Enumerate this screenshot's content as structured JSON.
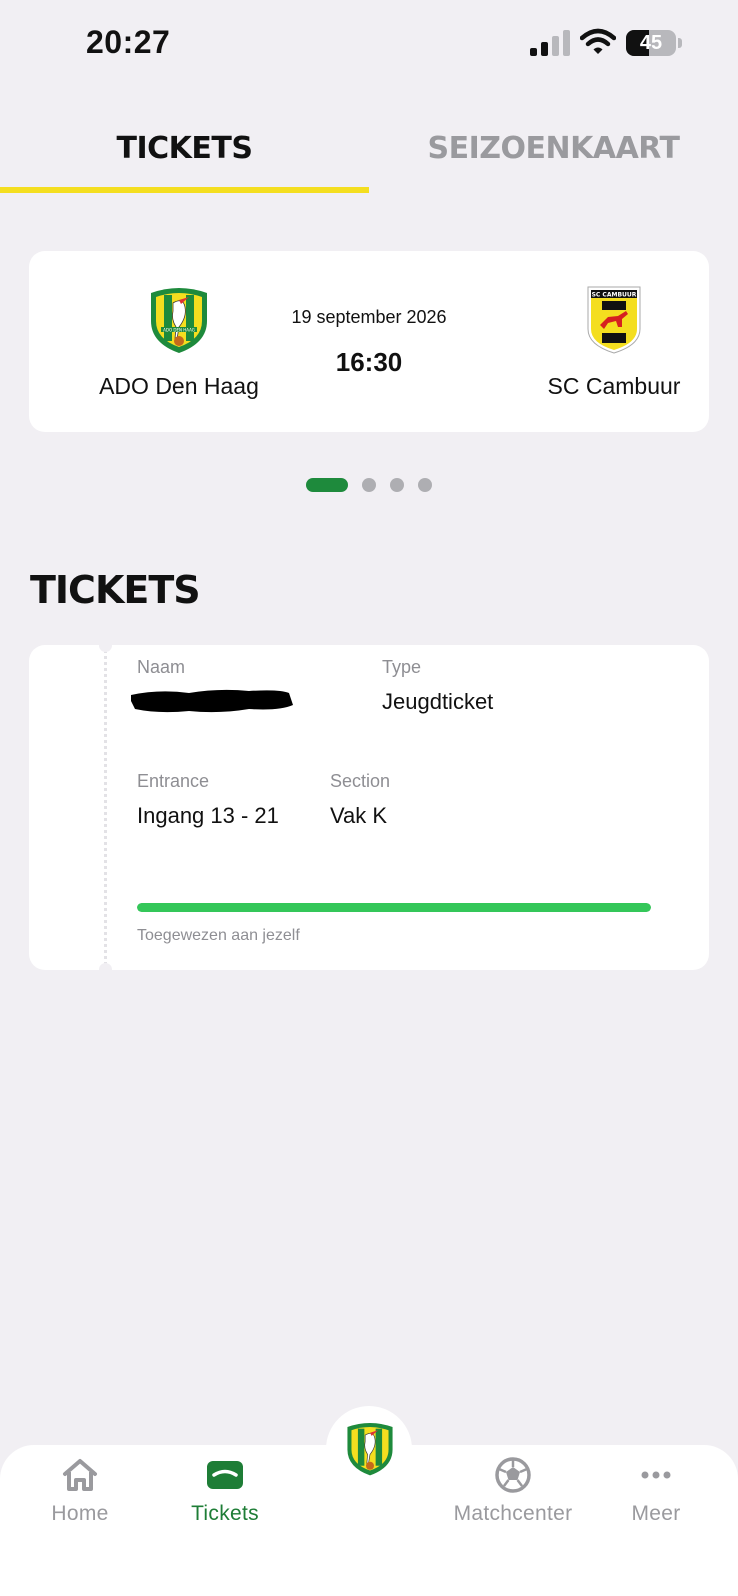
{
  "status_bar": {
    "time": "20:27",
    "battery_level": "45",
    "battery_fraction": 0.45
  },
  "tabs": [
    {
      "label": "TICKETS",
      "active": true
    },
    {
      "label": "SEIZOENKAART",
      "active": false
    }
  ],
  "match": {
    "home_team": "ADO Den Haag",
    "away_team": "SC Cambuur",
    "date": "19 september 2026",
    "time": "16:30",
    "away_crest_text": "SC CAMBUUR",
    "home_crest_text": "ADO DEN HAAG"
  },
  "pager": {
    "count": 4,
    "active_index": 0
  },
  "section_title": "TICKETS",
  "ticket": {
    "name_label": "Naam",
    "type_label": "Type",
    "type_value": "Jeugdticket",
    "entrance_label": "Entrance",
    "entrance_value": "Ingang 13 - 21",
    "section_label": "Section",
    "section_value": "Vak K",
    "progress_fraction": 1.0,
    "assignment_text": "Toegewezen aan jezelf"
  },
  "bottom_nav": {
    "items": [
      {
        "label": "Home",
        "icon": "home-icon",
        "active": false
      },
      {
        "label": "Tickets",
        "icon": "ticket-icon",
        "active": true
      },
      {
        "label": "Matchcenter",
        "icon": "football-icon",
        "active": false
      },
      {
        "label": "Meer",
        "icon": "more-icon",
        "active": false
      }
    ]
  },
  "colors": {
    "background": "#f1eff3",
    "accent_yellow": "#f4de1f",
    "brand_green": "#1e8a3c",
    "progress_green": "#34c759",
    "inactive_gray": "#9a9a9e"
  }
}
